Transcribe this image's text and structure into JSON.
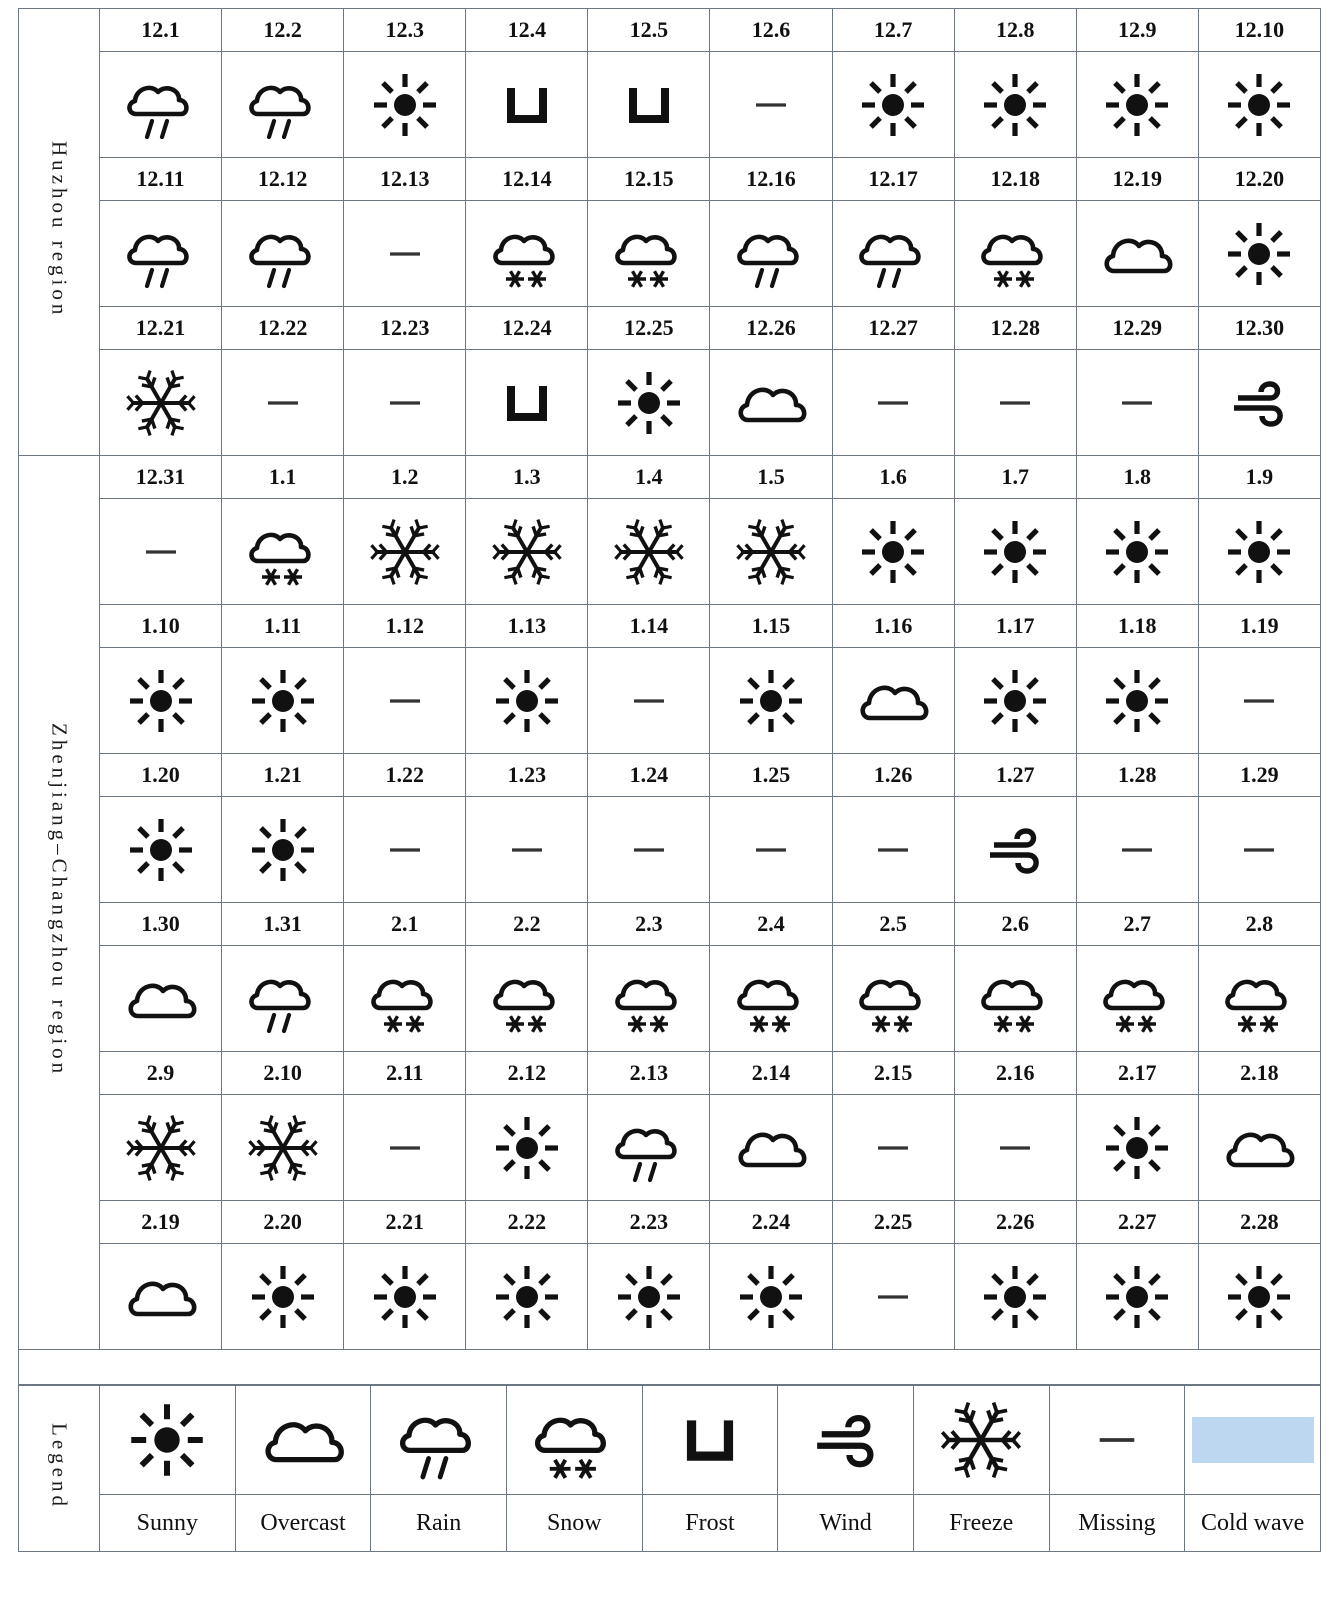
{
  "regions": [
    {
      "label": "Huzhou region",
      "rows": [
        {
          "dates": [
            "12.1",
            "12.2",
            "12.3",
            "12.4",
            "12.5",
            "12.6",
            "12.7",
            "12.8",
            "12.9",
            "12.10"
          ],
          "icons": [
            "rain",
            "rain",
            "sunny",
            "frost",
            "frost",
            "missing",
            "sunny",
            "sunny",
            "sunny",
            "sunny"
          ],
          "cold": [
            true,
            true,
            true,
            true,
            true,
            false,
            false,
            false,
            false,
            false
          ]
        },
        {
          "dates": [
            "12.11",
            "12.12",
            "12.13",
            "12.14",
            "12.15",
            "12.16",
            "12.17",
            "12.18",
            "12.19",
            "12.20"
          ],
          "icons": [
            "rain",
            "rain",
            "missing",
            "snow",
            "snow",
            "rain",
            "rain",
            "snow",
            "overcast",
            "sunny"
          ],
          "cold": [
            false,
            false,
            false,
            true,
            true,
            true,
            true,
            true,
            true,
            true
          ]
        },
        {
          "dates": [
            "12.21",
            "12.22",
            "12.23",
            "12.24",
            "12.25",
            "12.26",
            "12.27",
            "12.28",
            "12.29",
            "12.30"
          ],
          "icons": [
            "freeze",
            "missing",
            "missing",
            "frost",
            "sunny",
            "overcast",
            "missing",
            "missing",
            "missing",
            "wind"
          ],
          "cold": [
            true,
            false,
            false,
            false,
            false,
            false,
            false,
            false,
            false,
            false
          ]
        }
      ]
    },
    {
      "label": "Zhenjiang–Changzhou region",
      "rows": [
        {
          "dates": [
            "12.31",
            "1.1",
            "1.2",
            "1.3",
            "1.4",
            "1.5",
            "1.6",
            "1.7",
            "1.8",
            "1.9"
          ],
          "icons": [
            "missing",
            "snow",
            "freeze",
            "freeze",
            "freeze",
            "freeze",
            "sunny",
            "sunny",
            "sunny",
            "sunny"
          ],
          "cold": [
            false,
            true,
            true,
            true,
            true,
            true,
            false,
            false,
            false,
            false
          ]
        },
        {
          "dates": [
            "1.10",
            "1.11",
            "1.12",
            "1.13",
            "1.14",
            "1.15",
            "1.16",
            "1.17",
            "1.18",
            "1.19"
          ],
          "icons": [
            "sunny",
            "sunny",
            "missing",
            "sunny",
            "missing",
            "sunny",
            "overcast",
            "sunny",
            "sunny",
            "missing"
          ],
          "cold": [
            false,
            false,
            false,
            false,
            false,
            false,
            false,
            false,
            false,
            false
          ]
        },
        {
          "dates": [
            "1.20",
            "1.21",
            "1.22",
            "1.23",
            "1.24",
            "1.25",
            "1.26",
            "1.27",
            "1.28",
            "1.29"
          ],
          "icons": [
            "sunny",
            "sunny",
            "missing",
            "missing",
            "missing",
            "missing",
            "missing",
            "wind",
            "missing",
            "missing"
          ],
          "cold": [
            false,
            false,
            false,
            false,
            false,
            false,
            false,
            false,
            false,
            false
          ]
        },
        {
          "dates": [
            "1.30",
            "1.31",
            "2.1",
            "2.2",
            "2.3",
            "2.4",
            "2.5",
            "2.6",
            "2.7",
            "2.8"
          ],
          "icons": [
            "overcast",
            "rain",
            "snow",
            "snow",
            "snow",
            "snow",
            "snow",
            "snow",
            "snow",
            "snow"
          ],
          "cold": [
            false,
            false,
            true,
            true,
            true,
            true,
            true,
            true,
            true,
            true
          ]
        },
        {
          "dates": [
            "2.9",
            "2.10",
            "2.11",
            "2.12",
            "2.13",
            "2.14",
            "2.15",
            "2.16",
            "2.17",
            "2.18"
          ],
          "icons": [
            "freeze",
            "freeze",
            "missing",
            "sunny",
            "rain",
            "overcast",
            "missing",
            "missing",
            "sunny",
            "overcast"
          ],
          "cold": [
            true,
            true,
            false,
            false,
            false,
            false,
            false,
            false,
            false,
            false
          ]
        },
        {
          "dates": [
            "2.19",
            "2.20",
            "2.21",
            "2.22",
            "2.23",
            "2.24",
            "2.25",
            "2.26",
            "2.27",
            "2.28"
          ],
          "icons": [
            "overcast",
            "sunny",
            "sunny",
            "sunny",
            "sunny",
            "sunny",
            "missing",
            "sunny",
            "sunny",
            "sunny"
          ],
          "cold": [
            false,
            false,
            false,
            false,
            false,
            false,
            false,
            false,
            false,
            false
          ]
        }
      ]
    }
  ],
  "legend": {
    "label": "Legend",
    "items": [
      {
        "icon": "sunny",
        "text": "Sunny"
      },
      {
        "icon": "overcast",
        "text": "Overcast"
      },
      {
        "icon": "rain",
        "text": "Rain"
      },
      {
        "icon": "snow",
        "text": "Snow"
      },
      {
        "icon": "frost",
        "text": "Frost"
      },
      {
        "icon": "wind",
        "text": "Wind"
      },
      {
        "icon": "freeze",
        "text": "Freeze"
      },
      {
        "icon": "missing",
        "text": "Missing"
      },
      {
        "icon": "coldwave",
        "text": "Cold wave"
      }
    ]
  },
  "colors": {
    "cold_wave": "#bcd7ef",
    "grid_line": "#6d7683",
    "text": "#111111"
  }
}
